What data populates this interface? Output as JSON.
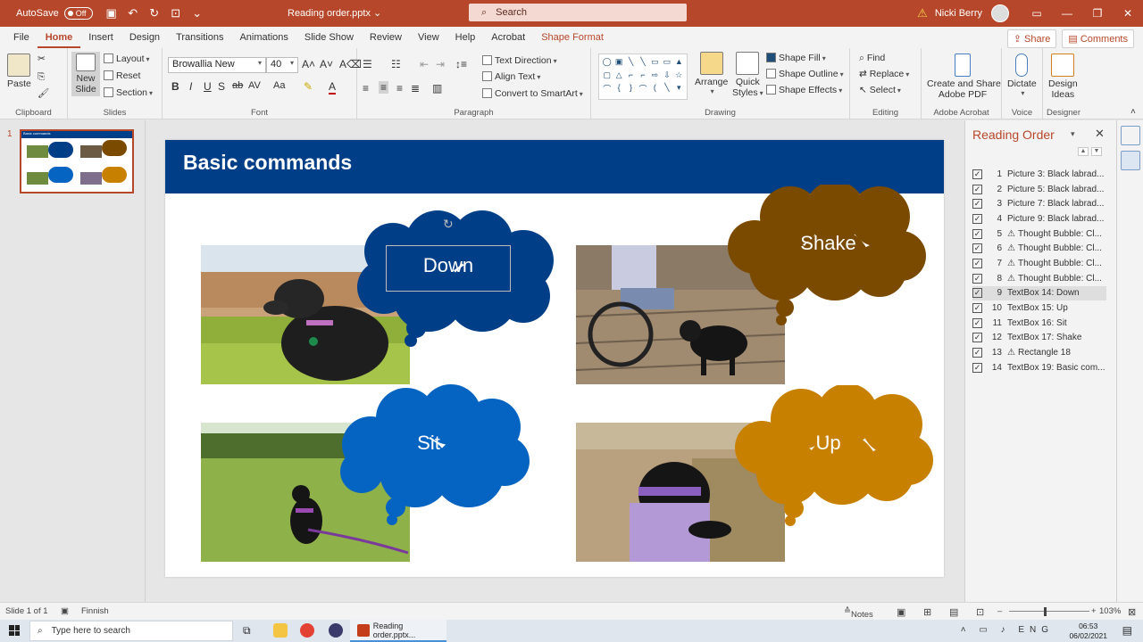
{
  "window": {
    "autosave_label": "AutoSave",
    "autosave_state": "Off",
    "doc_title": "Reading order.pptx",
    "search_placeholder": "Search",
    "user_name": "Nicki Berry"
  },
  "tabs": [
    "File",
    "Home",
    "Insert",
    "Design",
    "Transitions",
    "Animations",
    "Slide Show",
    "Review",
    "View",
    "Help",
    "Acrobat",
    "Shape Format"
  ],
  "active_tab": "Home",
  "share_label": "Share",
  "comments_label": "Comments",
  "ribbon": {
    "clipboard": {
      "label": "Clipboard",
      "paste": "Paste"
    },
    "slides": {
      "label": "Slides",
      "new_slide_1": "New",
      "new_slide_2": "Slide",
      "layout": "Layout",
      "reset": "Reset",
      "section": "Section"
    },
    "font": {
      "label": "Font",
      "family": "Browallia New",
      "size": "40"
    },
    "paragraph": {
      "label": "Paragraph",
      "text_direction": "Text Direction",
      "align_text": "Align Text",
      "convert_smartart": "Convert to SmartArt"
    },
    "drawing": {
      "label": "Drawing",
      "arrange": "Arrange",
      "quick_styles_1": "Quick",
      "quick_styles_2": "Styles",
      "shape_fill": "Shape Fill",
      "shape_outline": "Shape Outline",
      "shape_effects": "Shape Effects"
    },
    "editing": {
      "label": "Editing",
      "find": "Find",
      "replace": "Replace",
      "select": "Select"
    },
    "acrobat": {
      "label": "Adobe Acrobat",
      "create_1": "Create and Share",
      "create_2": "Adobe PDF"
    },
    "voice": {
      "label": "Voice",
      "dictate": "Dictate"
    },
    "designer": {
      "label": "Designer",
      "ideas_1": "Design",
      "ideas_2": "Ideas"
    }
  },
  "thumbnail": {
    "number": "1",
    "title": "Basic commands"
  },
  "slide": {
    "title": "Basic commands",
    "bubbles": [
      "Down",
      "Shake",
      "Sit",
      "Up"
    ]
  },
  "reading_order": {
    "title": "Reading Order",
    "items": [
      {
        "num": "1",
        "label": "Picture 3: Black labrad...",
        "warn": false
      },
      {
        "num": "2",
        "label": "Picture 5: Black labrad...",
        "warn": false
      },
      {
        "num": "3",
        "label": "Picture 7: Black labrad...",
        "warn": false
      },
      {
        "num": "4",
        "label": "Picture 9: Black labrad...",
        "warn": false
      },
      {
        "num": "5",
        "label": "Thought Bubble: Cl...",
        "warn": true
      },
      {
        "num": "6",
        "label": "Thought Bubble: Cl...",
        "warn": true
      },
      {
        "num": "7",
        "label": "Thought Bubble: Cl...",
        "warn": true
      },
      {
        "num": "8",
        "label": "Thought Bubble: Cl...",
        "warn": true
      },
      {
        "num": "9",
        "label": "TextBox 14: Down",
        "warn": false,
        "selected": true
      },
      {
        "num": "10",
        "label": "TextBox 15: Up",
        "warn": false
      },
      {
        "num": "11",
        "label": "TextBox 16: Sit",
        "warn": false
      },
      {
        "num": "12",
        "label": "TextBox 17: Shake",
        "warn": false
      },
      {
        "num": "13",
        "label": "Rectangle 18",
        "warn": true
      },
      {
        "num": "14",
        "label": "TextBox 19: Basic com...",
        "warn": false
      }
    ]
  },
  "status": {
    "slide_info": "Slide 1 of 1",
    "language": "Finnish",
    "notes": "Notes",
    "zoom": "103%"
  },
  "taskbar": {
    "search": "Type here to search",
    "ppt_label": "Reading order.pptx...",
    "time": "06:53",
    "date": "06/02/2021"
  },
  "colors": {
    "brand": "#b7472a",
    "title_bar": "#003f87",
    "bubble_dark": "#003f87",
    "bubble_brown": "#7a4a00",
    "bubble_blue": "#0563c1",
    "bubble_orange": "#c88000"
  }
}
